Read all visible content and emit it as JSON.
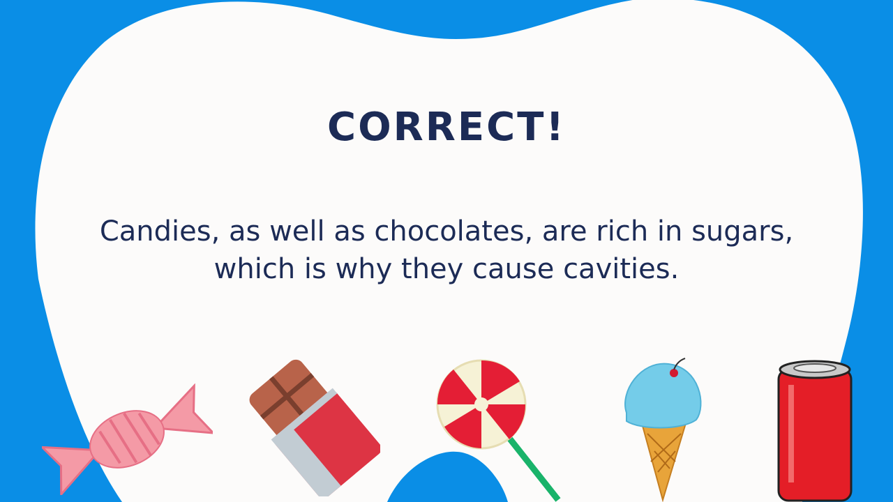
{
  "slide": {
    "title": "CORRECT!",
    "message": "Candies, as well as chocolates, are rich in sugars, which is why they cause cavities."
  },
  "colors": {
    "background": "#0a8ee6",
    "tooth": "#fcfbfa",
    "text": "#1c2b56"
  },
  "illustrations": [
    "wrapped-candy",
    "chocolate-bar",
    "lollipop",
    "ice-cream-cone",
    "soda-can"
  ]
}
